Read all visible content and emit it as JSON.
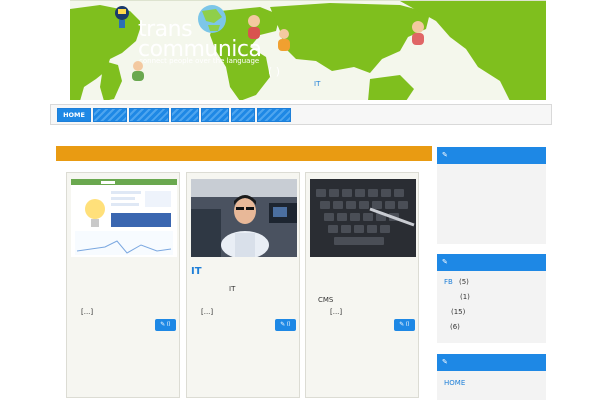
{
  "header": {
    "brand_line1": "trans",
    "brand_line2": "communica",
    "tagline": "connect people over the language",
    "paren_text": "( )",
    "it_text": "IT"
  },
  "nav": {
    "home_label": "HOME"
  },
  "cards": [
    {
      "title": "",
      "text1": "",
      "text2": "[...]",
      "button_icon": "✎ ⌷"
    },
    {
      "title": "IT",
      "text1": "IT",
      "text2": "[...]",
      "button_icon": "✎ ⌷"
    },
    {
      "title": "",
      "text1": "CMS",
      "text2": "[...]",
      "button_icon": "✎ ⌷"
    }
  ],
  "sidebar": {
    "widget_icon": "✎",
    "archive": {
      "fb_label": "FB",
      "fb_count": "(5)",
      "count2": "(1)",
      "count3": "(15)",
      "count4": "(6)"
    },
    "pages": {
      "home_label": "HOME"
    }
  },
  "colors": {
    "accent": "#1e88e5",
    "orange": "#e99b12",
    "map_green": "#7fbf1e"
  },
  "icons": [
    "edit-icon",
    "tag-icon",
    "lightbulb-icon"
  ]
}
